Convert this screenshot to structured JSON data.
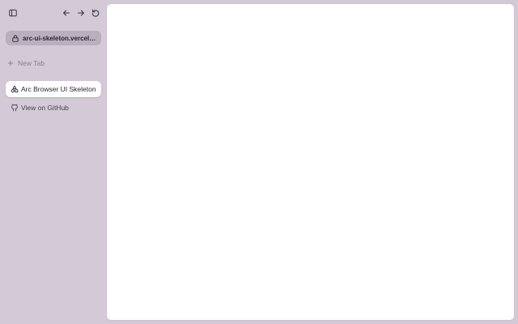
{
  "toolbar": {
    "sidebar_toggle_icon": "sidebar-toggle-icon",
    "back_icon": "arrow-left-icon",
    "forward_icon": "arrow-right-icon",
    "reload_icon": "reload-icon"
  },
  "url_bar": {
    "url": "arc-ui-skeleton.vercel.a...",
    "icon": "lock-icon"
  },
  "new_tab": {
    "label": "New Tab",
    "icon": "plus-icon"
  },
  "tabs": [
    {
      "label": "Arc Browser UI Skeleton",
      "icon": "shapes-icon",
      "active": true
    },
    {
      "label": "View on GitHub",
      "icon": "github-icon",
      "active": false
    }
  ],
  "colors": {
    "sidebar_bg": "#d3c9d7",
    "url_bar_bg": "#b9afbf",
    "content_bg": "#ffffff",
    "active_tab_bg": "#ffffff"
  }
}
